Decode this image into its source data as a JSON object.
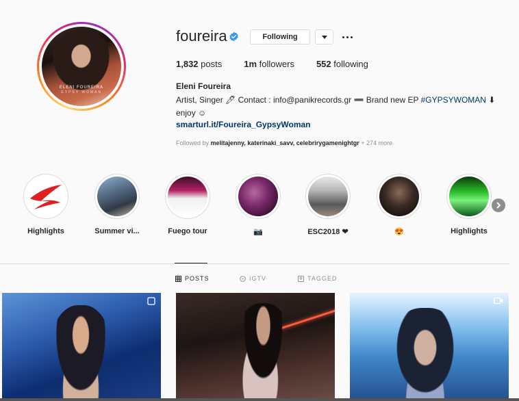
{
  "profile": {
    "username": "foureira",
    "following_button": "Following",
    "avatar_text_1": "ELENI FOUREIRA",
    "avatar_text_2": "GYPSY WOMAN",
    "stats": {
      "posts_count": "1,832",
      "posts_label": " posts",
      "followers_count": "1m",
      "followers_label": " followers",
      "following_count": "552",
      "following_label": " following"
    },
    "full_name": "Eleni Foureira",
    "bio_line1": "Artist, Singer 🖊 Contact : info@panikrecords.gr ➖ Brand new EP ",
    "bio_hashtag": "#GYPSYWOMAN",
    "bio_line1_end": " ⬇",
    "bio_line2": "enjoy ☺",
    "link": "smarturl.it/Foureira_GypsyWoman",
    "followed_by_prefix": "Followed by ",
    "followed_by_names": "melitajenny, katerinaki_savv, celebrirygamenightgr",
    "followed_by_suffix": " + 274 more"
  },
  "highlights": [
    {
      "label": "Highlights"
    },
    {
      "label": "Summer vi..."
    },
    {
      "label": "Fuego tour"
    },
    {
      "label": "📷"
    },
    {
      "label": "ESC2018 ❤"
    },
    {
      "label": "😍"
    },
    {
      "label": "Highlights"
    }
  ],
  "tabs": {
    "posts": "POSTS",
    "igtv": "IGTV",
    "tagged": "TAGGED"
  },
  "colors": {
    "verified_blue": "#3897f0",
    "link_blue": "#003569",
    "secondary_gray": "#8e8e8e",
    "border": "#dbdbdb"
  }
}
